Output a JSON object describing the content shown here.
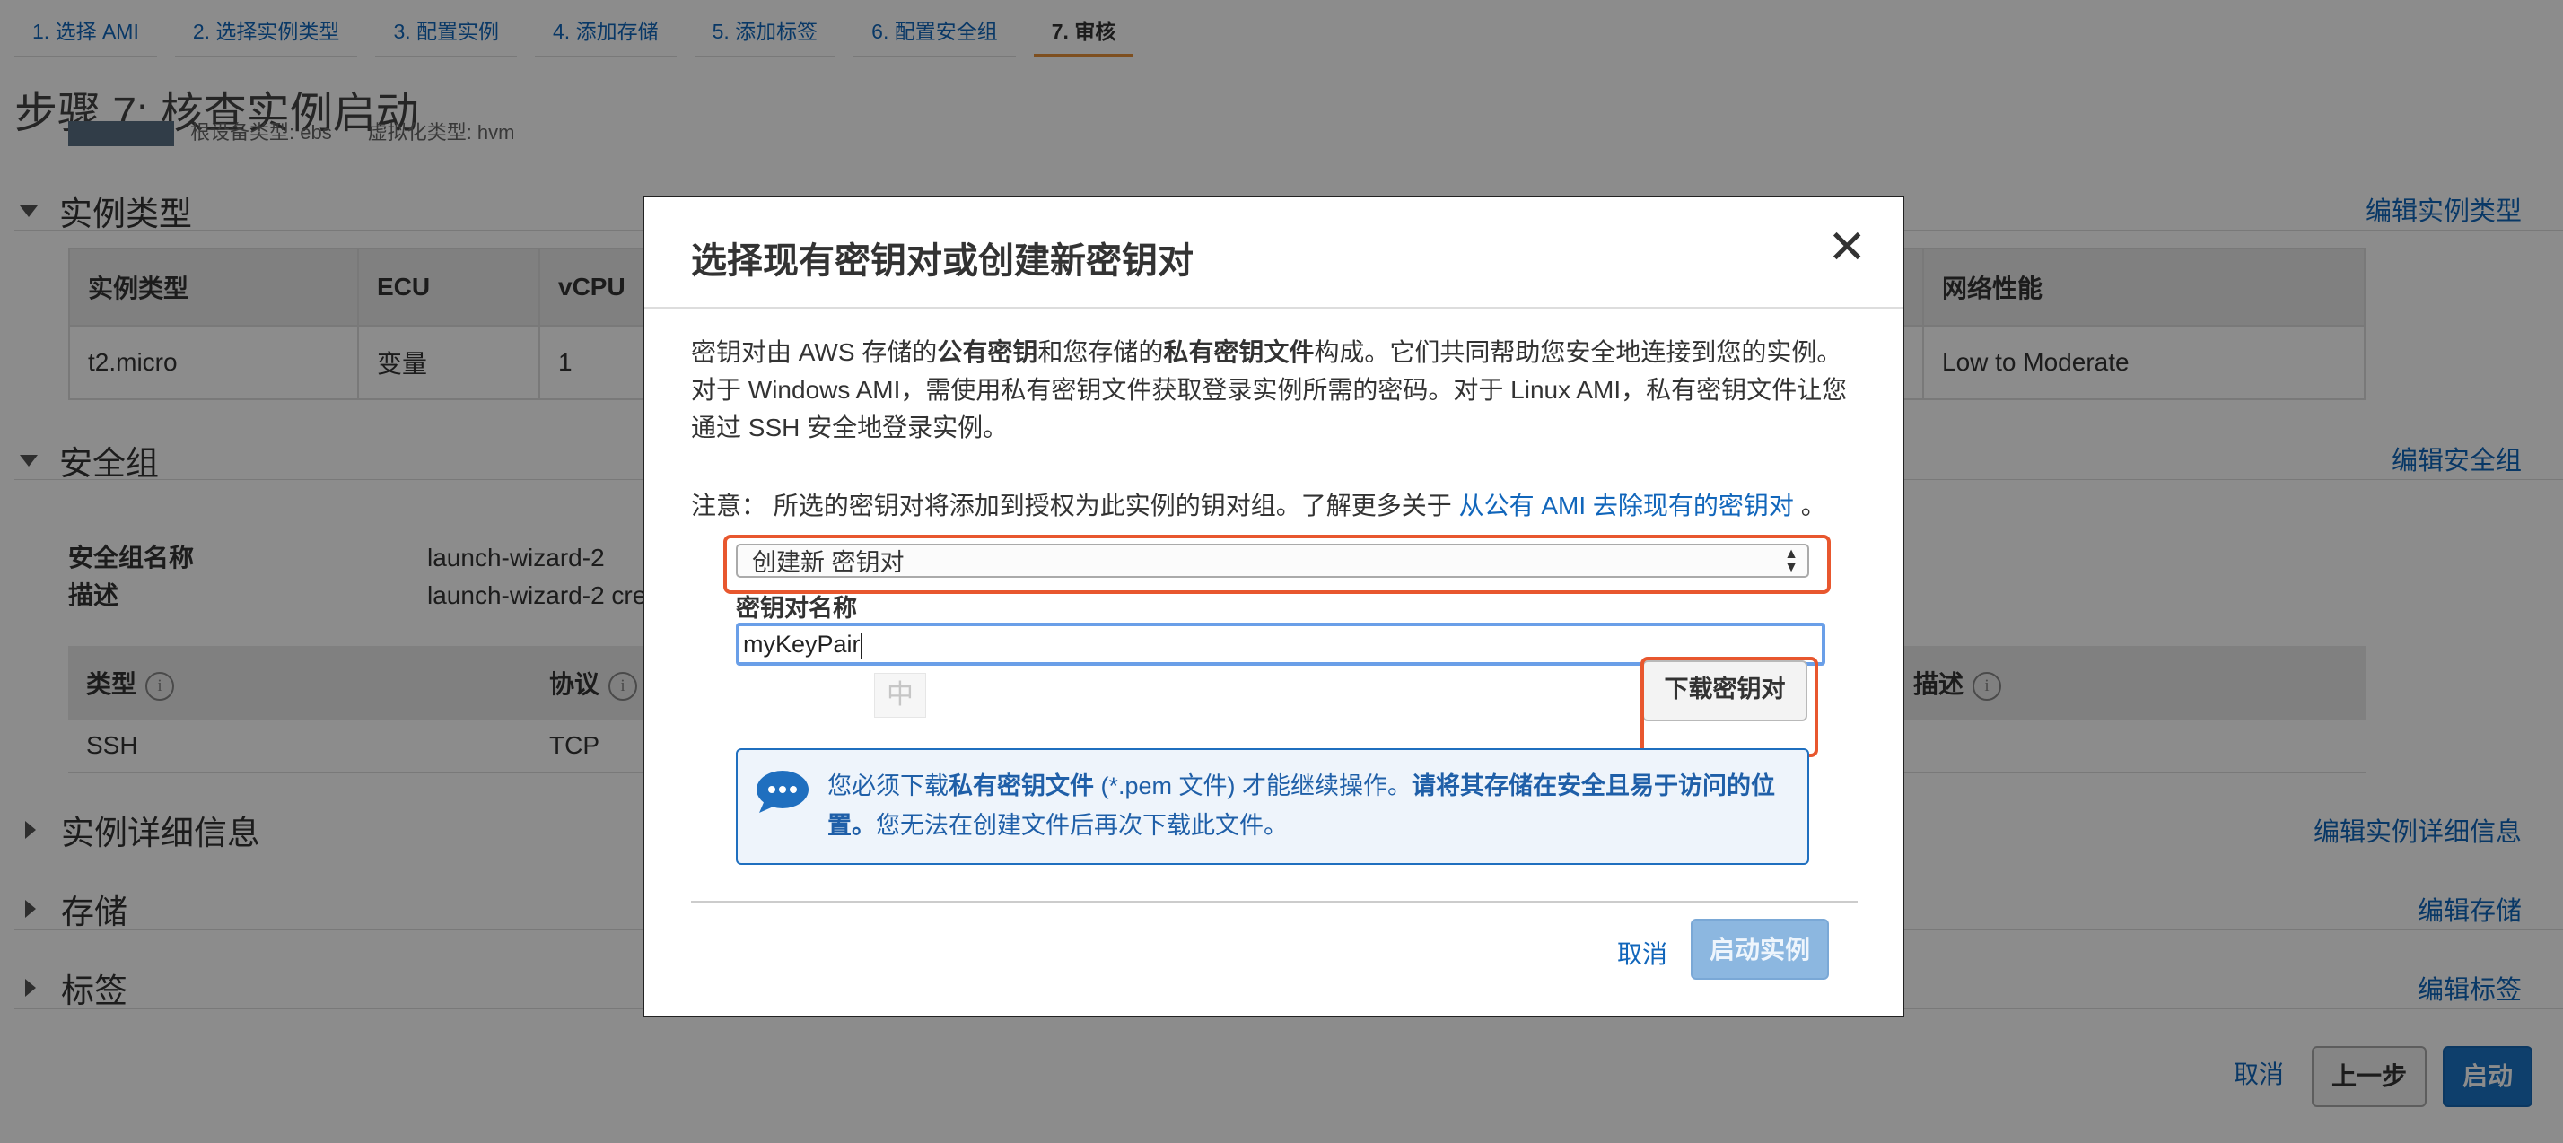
{
  "wizard": {
    "tabs": [
      {
        "label": "1. 选择 AMI"
      },
      {
        "label": "2. 选择实例类型"
      },
      {
        "label": "3. 配置实例"
      },
      {
        "label": "4. 添加存储"
      },
      {
        "label": "5. 添加标签"
      },
      {
        "label": "6. 配置安全组"
      },
      {
        "label": "7. 审核"
      }
    ],
    "active_tab": 6
  },
  "page": {
    "title": "步骤 7: 核查实例启动",
    "peek_root_device": "根设备类型: ebs",
    "peek_virtualization": "虚拟化类型: hvm"
  },
  "sections": {
    "instance_type": {
      "heading": "实例类型",
      "edit_link": "编辑实例类型",
      "columns": [
        "实例类型",
        "ECU",
        "vCPU",
        "网络性能"
      ],
      "row": [
        "t2.micro",
        "变量",
        "1",
        "Low to Moderate"
      ]
    },
    "security_group": {
      "heading": "安全组",
      "edit_link": "编辑安全组",
      "name_label": "安全组名称",
      "name_value": "launch-wizard-2",
      "desc_label": "描述",
      "desc_value": "launch-wizard-2 cre",
      "rule_columns": {
        "type": "类型",
        "protocol": "协议",
        "description": "描述"
      },
      "rule_row": {
        "type": "SSH",
        "protocol": "TCP"
      }
    },
    "details": {
      "heading": "实例详细信息",
      "edit_link": "编辑实例详细信息"
    },
    "storage": {
      "heading": "存储",
      "edit_link": "编辑存储"
    },
    "tags": {
      "heading": "标签",
      "edit_link": "编辑标签"
    }
  },
  "footer": {
    "cancel": "取消",
    "previous": "上一步",
    "launch": "启动"
  },
  "modal": {
    "title": "选择现有密钥对或创建新密钥对",
    "close_glyph": "✕",
    "body": {
      "p1": "密钥对由 AWS 存储的",
      "p1_b1": "公有密钥",
      "p1_2": "和您存储的",
      "p1_b2": "私有密钥文件",
      "p1_3": "构成。它们共同帮助您安全地连接到您的实例。对于 Windows AMI，需使用私有密钥文件获取登录实例所需的密码。对于 Linux AMI，私有密钥文件让您通过 SSH 安全地登录实例。"
    },
    "note_prefix": "注意：",
    "note_text": "所选的密钥对将添加到授权为此实例的钥对组。了解更多关于",
    "note_link": "从公有 AMI 去除现有的密钥对",
    "note_suffix": "。",
    "select_value": "创建新 密钥对",
    "key_name_label": "密钥对名称",
    "key_name_value": "myKeyPair",
    "ime_indicator": "中",
    "download_button": "下载密钥对",
    "alert": {
      "t1": "您必须下载",
      "b1": "私有密钥文件",
      "t2": " (*.pem 文件) 才能继续操作。",
      "b2": "请将其存储在安全且易于访问的位置。",
      "t3": "您无法在创建文件后再次下载此文件。"
    },
    "cancel": "取消",
    "launch_instance": "启动实例"
  },
  "colors": {
    "accent": "#1166bb",
    "highlight": "#e8572e",
    "active_tab": "#e5913a"
  }
}
